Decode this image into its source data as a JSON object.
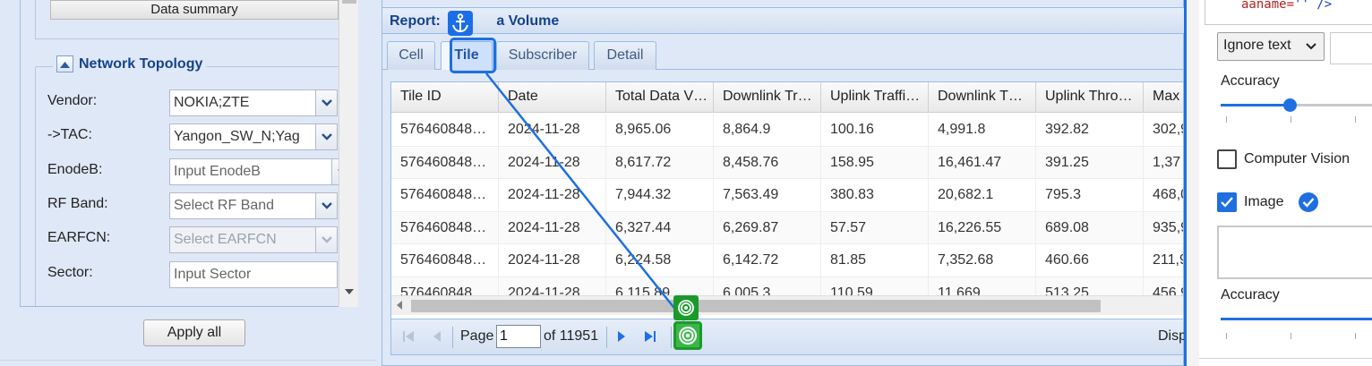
{
  "left_panel": {
    "data_summary_button": "Data summary",
    "topology_title": "Network Topology",
    "fields": [
      {
        "label": "Vendor:",
        "value": "NOKIA;ZTE",
        "placeholder": false,
        "disabled": false,
        "has_dropdown": true,
        "has_clear": true
      },
      {
        "label": "->TAC:",
        "value": "Yangon_SW_N;Yag",
        "placeholder": false,
        "disabled": false,
        "has_dropdown": true,
        "has_clear": true
      },
      {
        "label": "EnodeB:",
        "value": "Input EnodeB",
        "placeholder": true,
        "disabled": false,
        "has_dropdown": true,
        "has_clear": false
      },
      {
        "label": "RF Band:",
        "value": "Select RF Band",
        "placeholder": true,
        "disabled": false,
        "has_dropdown": true,
        "has_clear": true
      },
      {
        "label": "EARFCN:",
        "value": "Select EARFCN",
        "placeholder": true,
        "disabled": true,
        "has_dropdown": true,
        "has_clear": true
      },
      {
        "label": "Sector:",
        "value": "Input Sector",
        "placeholder": true,
        "disabled": false,
        "has_dropdown": false,
        "has_clear": true
      }
    ],
    "apply_all_button": "Apply all"
  },
  "report": {
    "title": "Report: ",
    "title_tail": "a Volume",
    "tabs": [
      {
        "label": "Cell",
        "active": false
      },
      {
        "label": "Tile",
        "active": true
      },
      {
        "label": "Subscriber",
        "active": false
      },
      {
        "label": "Detail",
        "active": false
      }
    ],
    "grid": {
      "columns": [
        "Tile ID",
        "Date",
        "Total Data V…",
        "Downlink Tr…",
        "Uplink Traffi…",
        "Downlink T…",
        "Uplink Thro…",
        "Max"
      ],
      "rows": [
        [
          "576460848…",
          "2024-11-28",
          "8,965.06",
          "8,864.9",
          "100.16",
          "4,991.8",
          "392.82",
          "302,9"
        ],
        [
          "576460848…",
          "2024-11-28",
          "8,617.72",
          "8,458.76",
          "158.95",
          "16,461.47",
          "391.25",
          "1,37"
        ],
        [
          "576460848…",
          "2024-11-28",
          "7,944.32",
          "7,563.49",
          "380.83",
          "20,682.1",
          "795.3",
          "468,0"
        ],
        [
          "576460848…",
          "2024-11-28",
          "6,327.44",
          "6,269.87",
          "57.57",
          "16,226.55",
          "689.08",
          "935,9"
        ],
        [
          "576460848…",
          "2024-11-28",
          "6,224.58",
          "6,142.72",
          "81.85",
          "7,352.68",
          "460.66",
          "211,9"
        ],
        [
          "576460848",
          "2024-11-28",
          "6,115.89",
          "6,005.3",
          "110.59",
          "11,669",
          "513.25",
          "456,9"
        ]
      ]
    },
    "pager": {
      "page_label": "Page",
      "page_value": "1",
      "of_label": "of 11951",
      "display_label": "Disp"
    }
  },
  "right_panel": {
    "code_attr": "aaname=",
    "code_tail": "'' />",
    "ignore_select": "Ignore text",
    "accuracy_label_1": "Accuracy",
    "accuracy_1_fraction": 0.43,
    "computer_vision_label": "Computer Vision",
    "computer_vision_checked": false,
    "image_label": "Image",
    "image_checked": true,
    "accuracy_label_2": "Accuracy",
    "accuracy_2_fraction": 1.0
  },
  "colors": {
    "accent": "#1f6fe0",
    "panel_bg": "#dfe8f6",
    "header_text": "#15428b",
    "target_green": "#1a9a2a"
  },
  "icons": {
    "anchor": "anchor-icon",
    "target": "target-icon",
    "collapse": "collapse-up-icon",
    "first": "first-page-icon",
    "prev": "prev-page-icon",
    "next": "next-page-icon",
    "last": "last-page-icon",
    "verified": "verified-check-icon"
  }
}
